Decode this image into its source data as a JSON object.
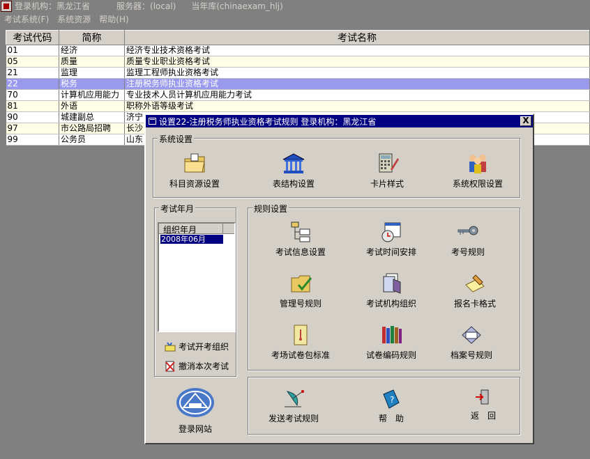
{
  "titlebar": {
    "org": "登录机构：黑龙江省",
    "server": "服务器：(local)",
    "db": "当年库(chinaexam_hlj)"
  },
  "menu": [
    "考试系统(F)",
    "系统资源",
    "帮助(H)"
  ],
  "table": {
    "headers": [
      "考试代码",
      "简称",
      "考试名称"
    ],
    "rows": [
      {
        "code": "01",
        "short": "经济",
        "name": "经济专业技术资格考试"
      },
      {
        "code": "05",
        "short": "质量",
        "name": "质量专业职业资格考试"
      },
      {
        "code": "21",
        "short": "监理",
        "name": "监理工程师执业资格考试"
      },
      {
        "code": "22",
        "short": "税务",
        "name": "注册税务师执业资格考试"
      },
      {
        "code": "70",
        "short": "计算机应用能力",
        "name": "专业技术人员计算机应用能力考试"
      },
      {
        "code": "81",
        "short": "外语",
        "name": "职称外语等级考试"
      },
      {
        "code": "90",
        "short": "城建副总",
        "name": "济宁"
      },
      {
        "code": "97",
        "short": "市公路局招聘",
        "name": "长沙"
      },
      {
        "code": "99",
        "short": "公务员",
        "name": "山东"
      }
    ]
  },
  "dialog": {
    "title": "设置22-注册税务师执业资格考试规则  登录机构：黑龙江省",
    "close": "X",
    "system_group": "系统设置",
    "system_tools": [
      "科目资源设置",
      "表结构设置",
      "卡片样式",
      "系统权限设置"
    ],
    "year_group": "考试年月",
    "year_list_header": "组织年月",
    "year_list_item": "2008年06月",
    "open_exam": "考试开考组织",
    "cancel_exam": "撤消本次考试",
    "rules_group": "规则设置",
    "rules_tools": [
      "考试信息设置",
      "考试时间安排",
      "考号规则",
      "管理号规则",
      "考试机构组织",
      "报名卡格式",
      "考场试卷包标准",
      "试卷编码规则",
      "档案号规则"
    ],
    "login_site": "登录网站",
    "send_rules": "发送考试规则",
    "help": "帮　助",
    "back": "返　回"
  },
  "colors": {
    "selection": "#9999ee",
    "title_blue": "#000080"
  }
}
